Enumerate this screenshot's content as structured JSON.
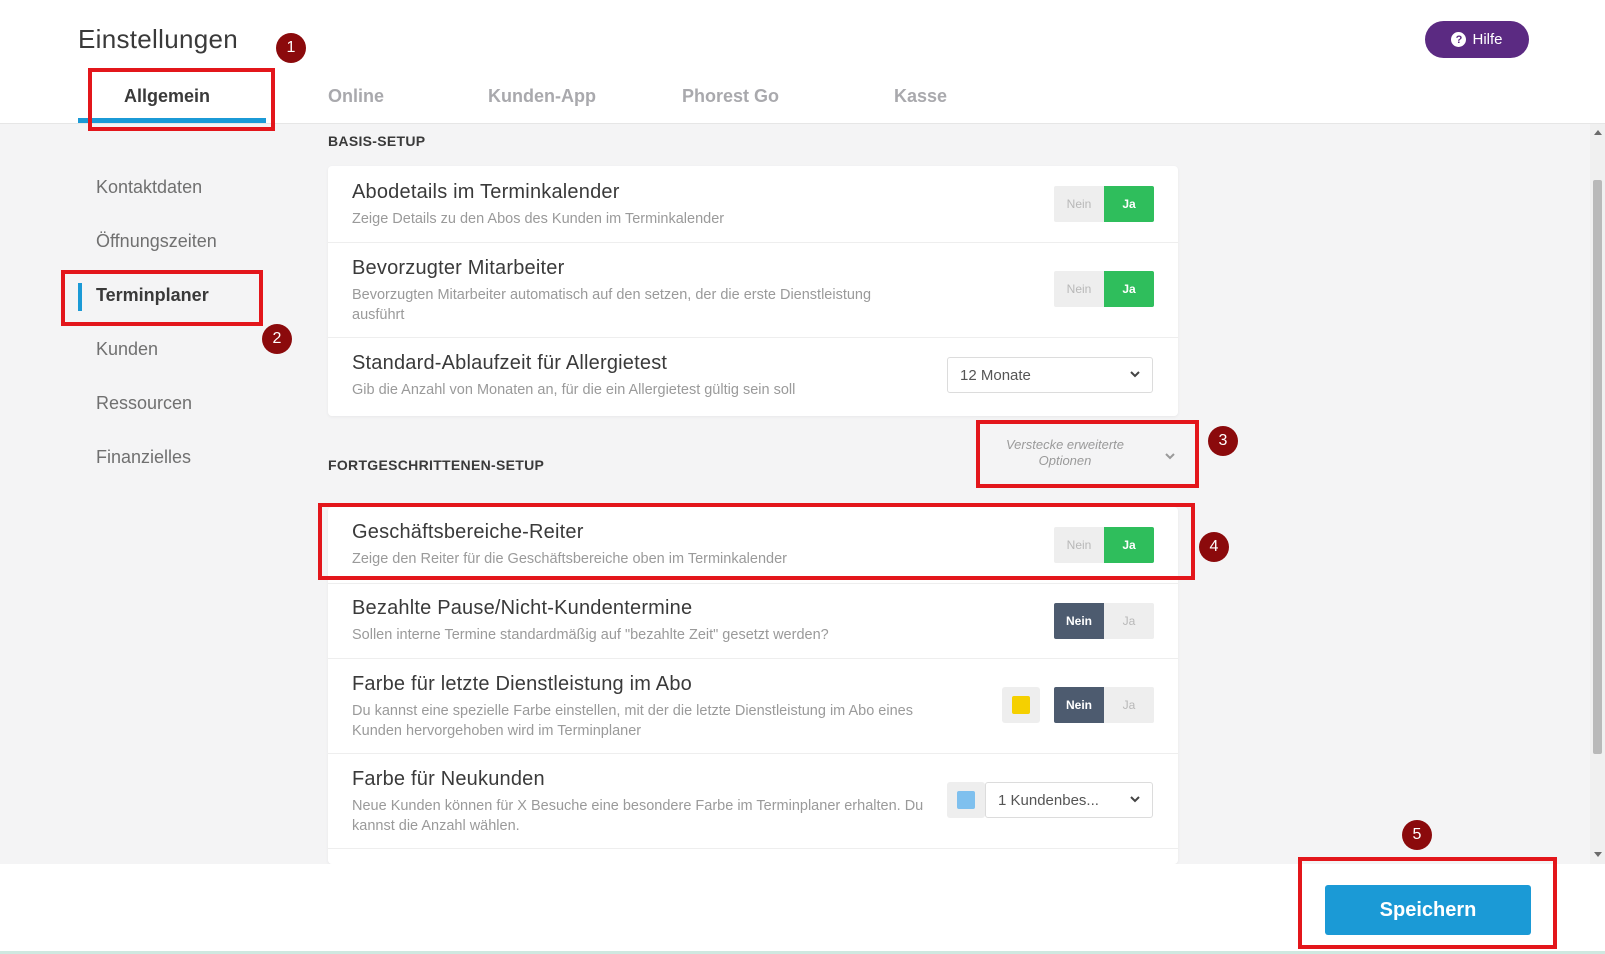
{
  "header": {
    "title": "Einstellungen",
    "help_label": "Hilfe"
  },
  "tabs": [
    "Allgemein",
    "Online",
    "Kunden-App",
    "Phorest Go",
    "Kasse"
  ],
  "sidebar": {
    "items": [
      "Kontaktdaten",
      "Öffnungszeiten",
      "Terminplaner",
      "Kunden",
      "Ressourcen",
      "Finanzielles"
    ],
    "active": "Terminplaner"
  },
  "basis": {
    "heading": "BASIS-SETUP",
    "rows": [
      {
        "title": "Abodetails im Terminkalender",
        "desc": "Zeige Details zu den Abos des Kunden im Terminkalender",
        "toggle": "Ja"
      },
      {
        "title": "Bevorzugter Mitarbeiter",
        "desc": "Bevorzugten Mitarbeiter automatisch auf den setzen, der die erste Dienstleistung ausführt",
        "toggle": "Ja"
      },
      {
        "title": "Standard-Ablaufzeit für Allergietest",
        "desc": "Gib die Anzahl von Monaten an, für die ein Allergietest gültig sein soll",
        "select": "12 Monate"
      }
    ]
  },
  "advanced": {
    "heading": "FORTGESCHRITTENEN-SETUP",
    "toggle_link": "Verstecke erweiterte Optionen",
    "rows": [
      {
        "title": "Geschäftsbereiche-Reiter",
        "desc": "Zeige den Reiter für die Geschäftsbereiche oben im Terminkalender",
        "toggle": "Ja"
      },
      {
        "title": "Bezahlte Pause/Nicht-Kundentermine",
        "desc": "Sollen interne Termine standardmäßig auf \"bezahlte Zeit\" gesetzt werden?",
        "toggle": "Nein"
      },
      {
        "title": "Farbe für letzte Dienstleistung im Abo",
        "desc": "Du kannst eine spezielle Farbe einstellen, mit der die letzte Dienstleistung im Abo eines Kunden hervorgehoben wird im Terminplaner",
        "toggle": "Nein",
        "color": "#f5d000"
      },
      {
        "title": "Farbe für Neukunden",
        "desc": "Neue Kunden können für X Besuche eine besondere Farbe im Terminplaner erhalten. Du kannst die Anzahl wählen.",
        "select": "1 Kundenbes...",
        "color": "#7fc0ee"
      }
    ]
  },
  "toggle_labels": {
    "no": "Nein",
    "yes": "Ja"
  },
  "footer": {
    "save_label": "Speichern"
  },
  "annotations": [
    "1",
    "2",
    "3",
    "4",
    "5"
  ],
  "colors": {
    "accent": "#1b9ad6",
    "help": "#5b2a82",
    "toggle_yes": "#2fbe5c",
    "toggle_no": "#4d5b6f",
    "annotation": "#e3161b"
  }
}
